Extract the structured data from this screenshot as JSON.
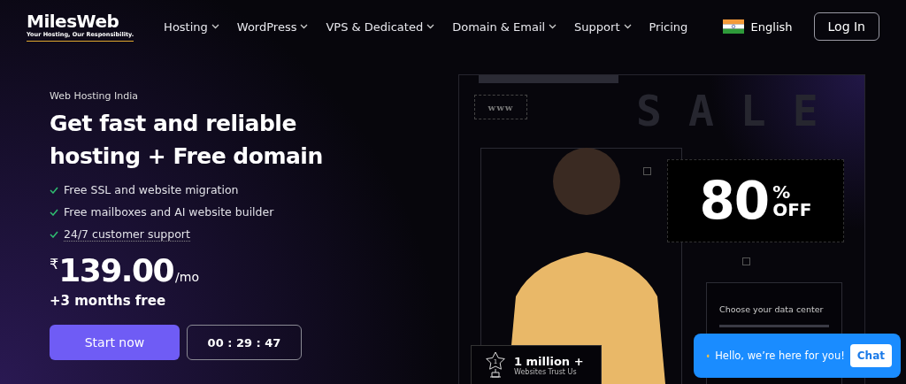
{
  "logo": {
    "name": "MilesWeb",
    "tagline": "Your Hosting, Our Responsibility."
  },
  "nav": [
    {
      "label": "Hosting",
      "dropdown": true
    },
    {
      "label": "WordPress",
      "dropdown": true
    },
    {
      "label": "VPS & Dedicated",
      "dropdown": true
    },
    {
      "label": "Domain & Email",
      "dropdown": true
    },
    {
      "label": "Support",
      "dropdown": true
    },
    {
      "label": "Pricing",
      "dropdown": false
    }
  ],
  "language": {
    "label": "English"
  },
  "login": "Log In",
  "hero": {
    "eyebrow": "Web Hosting India",
    "title": "Get fast and reliable hosting + Free domain",
    "features": [
      {
        "text": "Free SSL and website migration",
        "underlined": false
      },
      {
        "text": "Free mailboxes and AI website builder",
        "underlined": false
      },
      {
        "text": "24/7 customer support",
        "underlined": true
      }
    ],
    "price": {
      "currency": "₹",
      "amount": "139.00",
      "period": "/mo"
    },
    "bonus": "+3 months free",
    "cta": "Start now",
    "countdown": "00 : 29 : 47"
  },
  "art": {
    "www": "www",
    "sale": "SALE",
    "discount": {
      "value": "80",
      "percent": "%",
      "off": "OFF"
    },
    "datacenter": "Choose your data center",
    "badge": {
      "rank": "1",
      "title": "1 million +",
      "subtitle": "Websites Trust Us"
    }
  },
  "chat": {
    "message": "Hello, we’re here for you!",
    "button": "Chat"
  }
}
